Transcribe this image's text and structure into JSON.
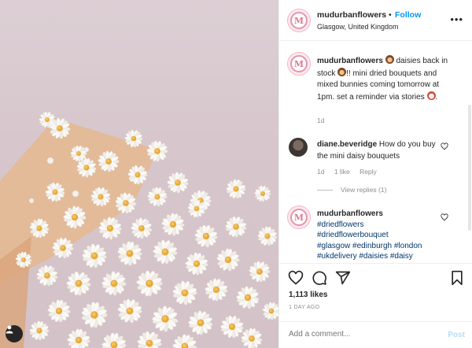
{
  "post": {
    "photo_alt": "",
    "tag_icon": "user-icon"
  },
  "header": {
    "username": "mudurbanflowers",
    "separator": "•",
    "follow_label": "Follow",
    "location": "Glasgow, United Kingdom",
    "more_icon": "more-horizontal-icon",
    "more_label": "•••",
    "avatar_letter": "M"
  },
  "caption": {
    "username": "mudurbanflowers",
    "text_1": "daisies back in stock",
    "text_2": "!! mini dried bouquets and mixed bunnies coming tomorrow at 1pm. set a reminder via stories",
    "text_3": ".",
    "time": "1d"
  },
  "comment": {
    "username": "diane.beveridge",
    "text": "How do you buy the mini daisy bouquets",
    "time": "1d",
    "likes": "1 like",
    "reply": "Reply",
    "view_replies": "View replies (1)"
  },
  "tags_comment": {
    "username": "mudurbanflowers",
    "tags": [
      "#driedflowers",
      "#driedflowerbouquet",
      "#glasgow",
      "#edinburgh",
      "#london",
      "#ukdelivery",
      "#daisies",
      "#daisy"
    ]
  },
  "actions": {
    "likes": "1,113 likes",
    "posted_ago": "1 DAY AGO",
    "add_comment_placeholder": "Add a comment...",
    "post_label": "Post"
  },
  "colors": {
    "follow": "#0095f6",
    "link": "#00376b",
    "muted": "#8e8e8e",
    "background_photo": "#d7c7cd"
  }
}
